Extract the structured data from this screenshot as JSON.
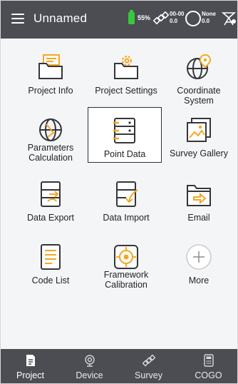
{
  "header": {
    "title": "Unnamed",
    "battery_pct": "55%",
    "satellite_line1": "00-00",
    "satellite_line2": "0.0",
    "diff_line1": "None",
    "diff_line2": "0.0"
  },
  "menu": {
    "tiles": [
      {
        "label": "Project Info",
        "icon": "folder-info-icon"
      },
      {
        "label": "Project Settings",
        "icon": "folder-settings-icon"
      },
      {
        "label": "Coordinate System",
        "icon": "globe-pin-icon"
      },
      {
        "label": "Parameters Calculation",
        "icon": "globe-calc-icon"
      },
      {
        "label": "Point Data",
        "icon": "point-data-icon"
      },
      {
        "label": "Survey Gallery",
        "icon": "gallery-icon"
      },
      {
        "label": "Data Export",
        "icon": "data-export-icon"
      },
      {
        "label": "Data Import",
        "icon": "data-import-icon"
      },
      {
        "label": "Email",
        "icon": "email-folder-icon"
      },
      {
        "label": "Code List",
        "icon": "code-list-icon"
      },
      {
        "label": "Framework Calibration",
        "icon": "framework-calibration-icon"
      },
      {
        "label": "More",
        "icon": "plus-icon"
      }
    ],
    "selected_tile": "Point Data"
  },
  "bottom_nav": {
    "items": [
      {
        "label": "Project",
        "icon": "project-icon"
      },
      {
        "label": "Device",
        "icon": "device-icon"
      },
      {
        "label": "Survey",
        "icon": "survey-icon"
      },
      {
        "label": "COGO",
        "icon": "cogo-icon"
      }
    ],
    "active": "Project"
  },
  "colors": {
    "bar": "#4b4d52",
    "accent": "#f6a623",
    "battery": "#37c83e",
    "background": "#f4f5f7"
  }
}
